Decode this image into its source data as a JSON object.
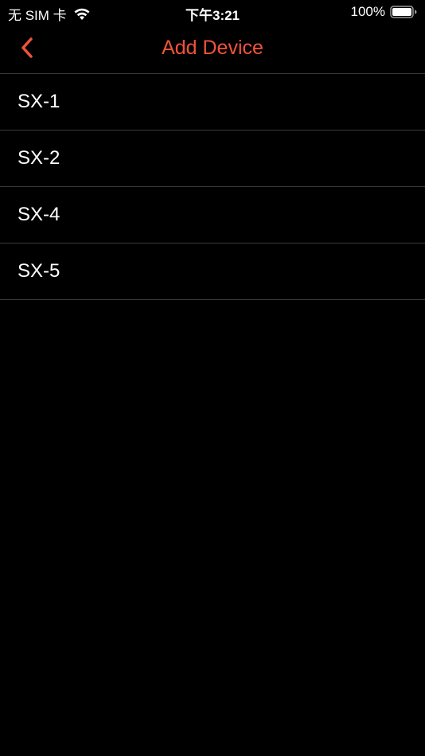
{
  "status_bar": {
    "carrier": "无 SIM 卡",
    "time": "下午3:21",
    "battery": "100%"
  },
  "nav": {
    "title": "Add Device",
    "back_icon": "chevron-left-icon"
  },
  "colors": {
    "accent": "#f0533a",
    "background": "#000000",
    "separator": "#3a3a3c",
    "text": "#ffffff"
  },
  "devices": [
    {
      "label": "SX-1"
    },
    {
      "label": "SX-2"
    },
    {
      "label": "SX-4"
    },
    {
      "label": "SX-5"
    }
  ]
}
